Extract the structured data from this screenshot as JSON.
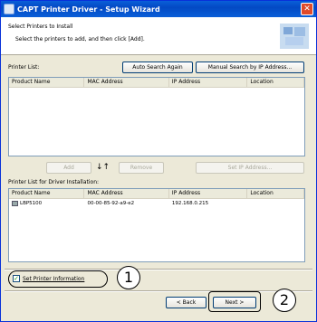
{
  "window": {
    "title": "CAPT Printer Driver - Setup Wizard",
    "close_glyph": "✕"
  },
  "header": {
    "title": "Select Printers to Install",
    "subtitle": "Select the printers to add, and then click [Add]."
  },
  "printer_list": {
    "label": "Printer List:",
    "auto_search_label": "Auto Search Again",
    "manual_search_label": "Manual Search by IP Address...",
    "columns": [
      "Product Name",
      "MAC Address",
      "IP Address",
      "Location"
    ]
  },
  "actions": {
    "add_label": "Add",
    "arrows": "↓↑",
    "remove_label": "Remove",
    "set_ip_label": "Set IP Address..."
  },
  "install_list": {
    "label": "Printer List for Driver Installation:",
    "columns": [
      "Product Name",
      "MAC Address",
      "IP Address",
      "Location"
    ],
    "rows": [
      {
        "product": "LBP5100",
        "mac": "00-00-85-92-a9-e2",
        "ip": "192.168.0.215",
        "location": ""
      }
    ]
  },
  "footer": {
    "set_printer_info_label": "Set Printer Information",
    "set_printer_info_checked": true,
    "back_label": "< Back",
    "next_label": "Next >",
    "callout_1": "1",
    "callout_2": "2"
  },
  "icons": {
    "title_icon": "printer-app-icon",
    "header_graphic": "printer-wizard-graphic",
    "row_icon": "printer-icon"
  }
}
